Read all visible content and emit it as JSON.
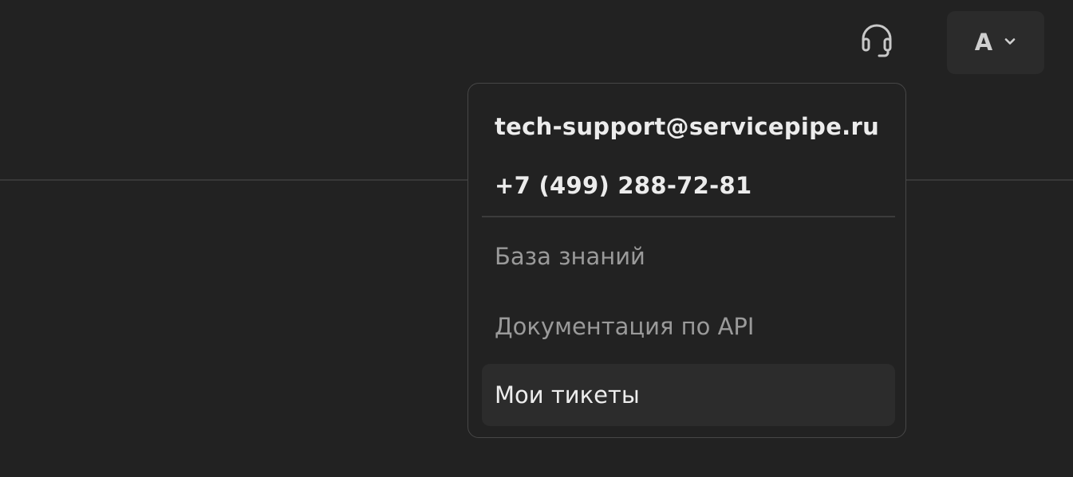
{
  "header": {
    "support_icon": "headset-icon",
    "account": {
      "initial": "А",
      "dropdown_icon": "chevron-down-icon"
    }
  },
  "support_menu": {
    "email": "tech-support@servicepipe.ru",
    "phone": "+7 (499) 288-72-81",
    "items": [
      {
        "label": "База знаний",
        "active": false
      },
      {
        "label": "Документация по API",
        "active": false
      },
      {
        "label": "Мои тикеты",
        "active": true
      }
    ]
  },
  "colors": {
    "background": "#222222",
    "surface": "#2b2b2b",
    "hover_item": "#2c2c2c",
    "border": "#474747",
    "text_primary": "#ececec",
    "text_secondary": "#9a9a9a"
  }
}
